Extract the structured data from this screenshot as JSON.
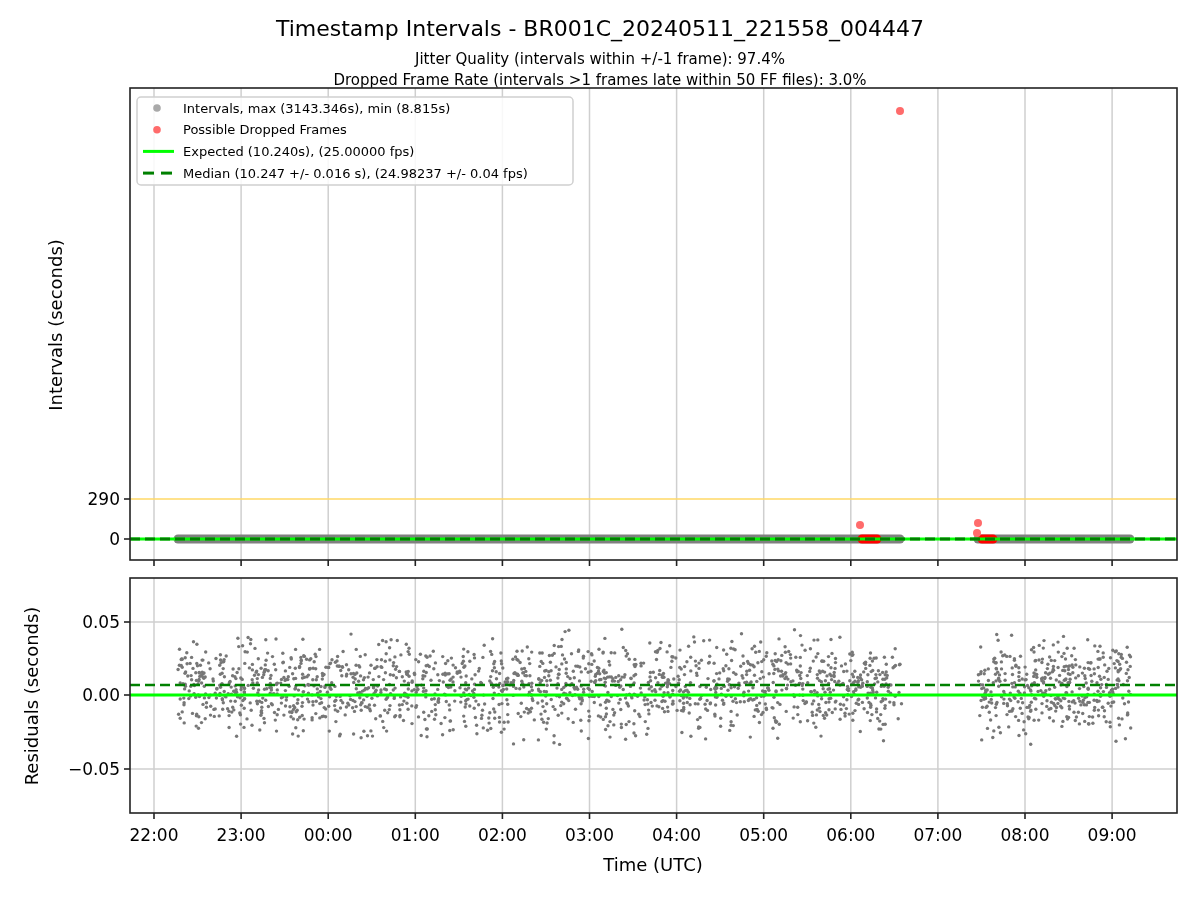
{
  "title": "Timestamp Intervals - BR001C_20240511_221558_004447",
  "subtitles": [
    "Jitter Quality (intervals within +/-1 frame): 97.4%",
    "Dropped Frame Rate (intervals >1 frames late within 50 FF files): 3.0%"
  ],
  "legend": {
    "items": [
      {
        "kind": "marker",
        "label": "Intervals, max (3143.346s), min (8.815s)",
        "color": "#a9a9a9"
      },
      {
        "kind": "marker",
        "label": "Possible Dropped Frames",
        "color": "#ff6b6b"
      },
      {
        "kind": "line",
        "label": "Expected (10.240s), (25.00000 fps)",
        "color": "#00ff00"
      },
      {
        "kind": "dashed-line",
        "label": "Median (10.247 +/- 0.016 s), (24.98237 +/- 0.04 fps)",
        "color": "#008000"
      }
    ]
  },
  "top_panel": {
    "ylabel": "Intervals (seconds)",
    "yticks": [
      "290",
      "0"
    ]
  },
  "bottom_panel": {
    "ylabel": "Residuals (seconds)",
    "yticks": [
      "0.05",
      "0.00",
      "−0.05"
    ]
  },
  "xticks": [
    "22:00",
    "23:00",
    "00:00",
    "01:00",
    "02:00",
    "03:00",
    "04:00",
    "05:00",
    "06:00",
    "07:00",
    "08:00",
    "09:00"
  ],
  "xlabel": "Time (UTC)"
}
